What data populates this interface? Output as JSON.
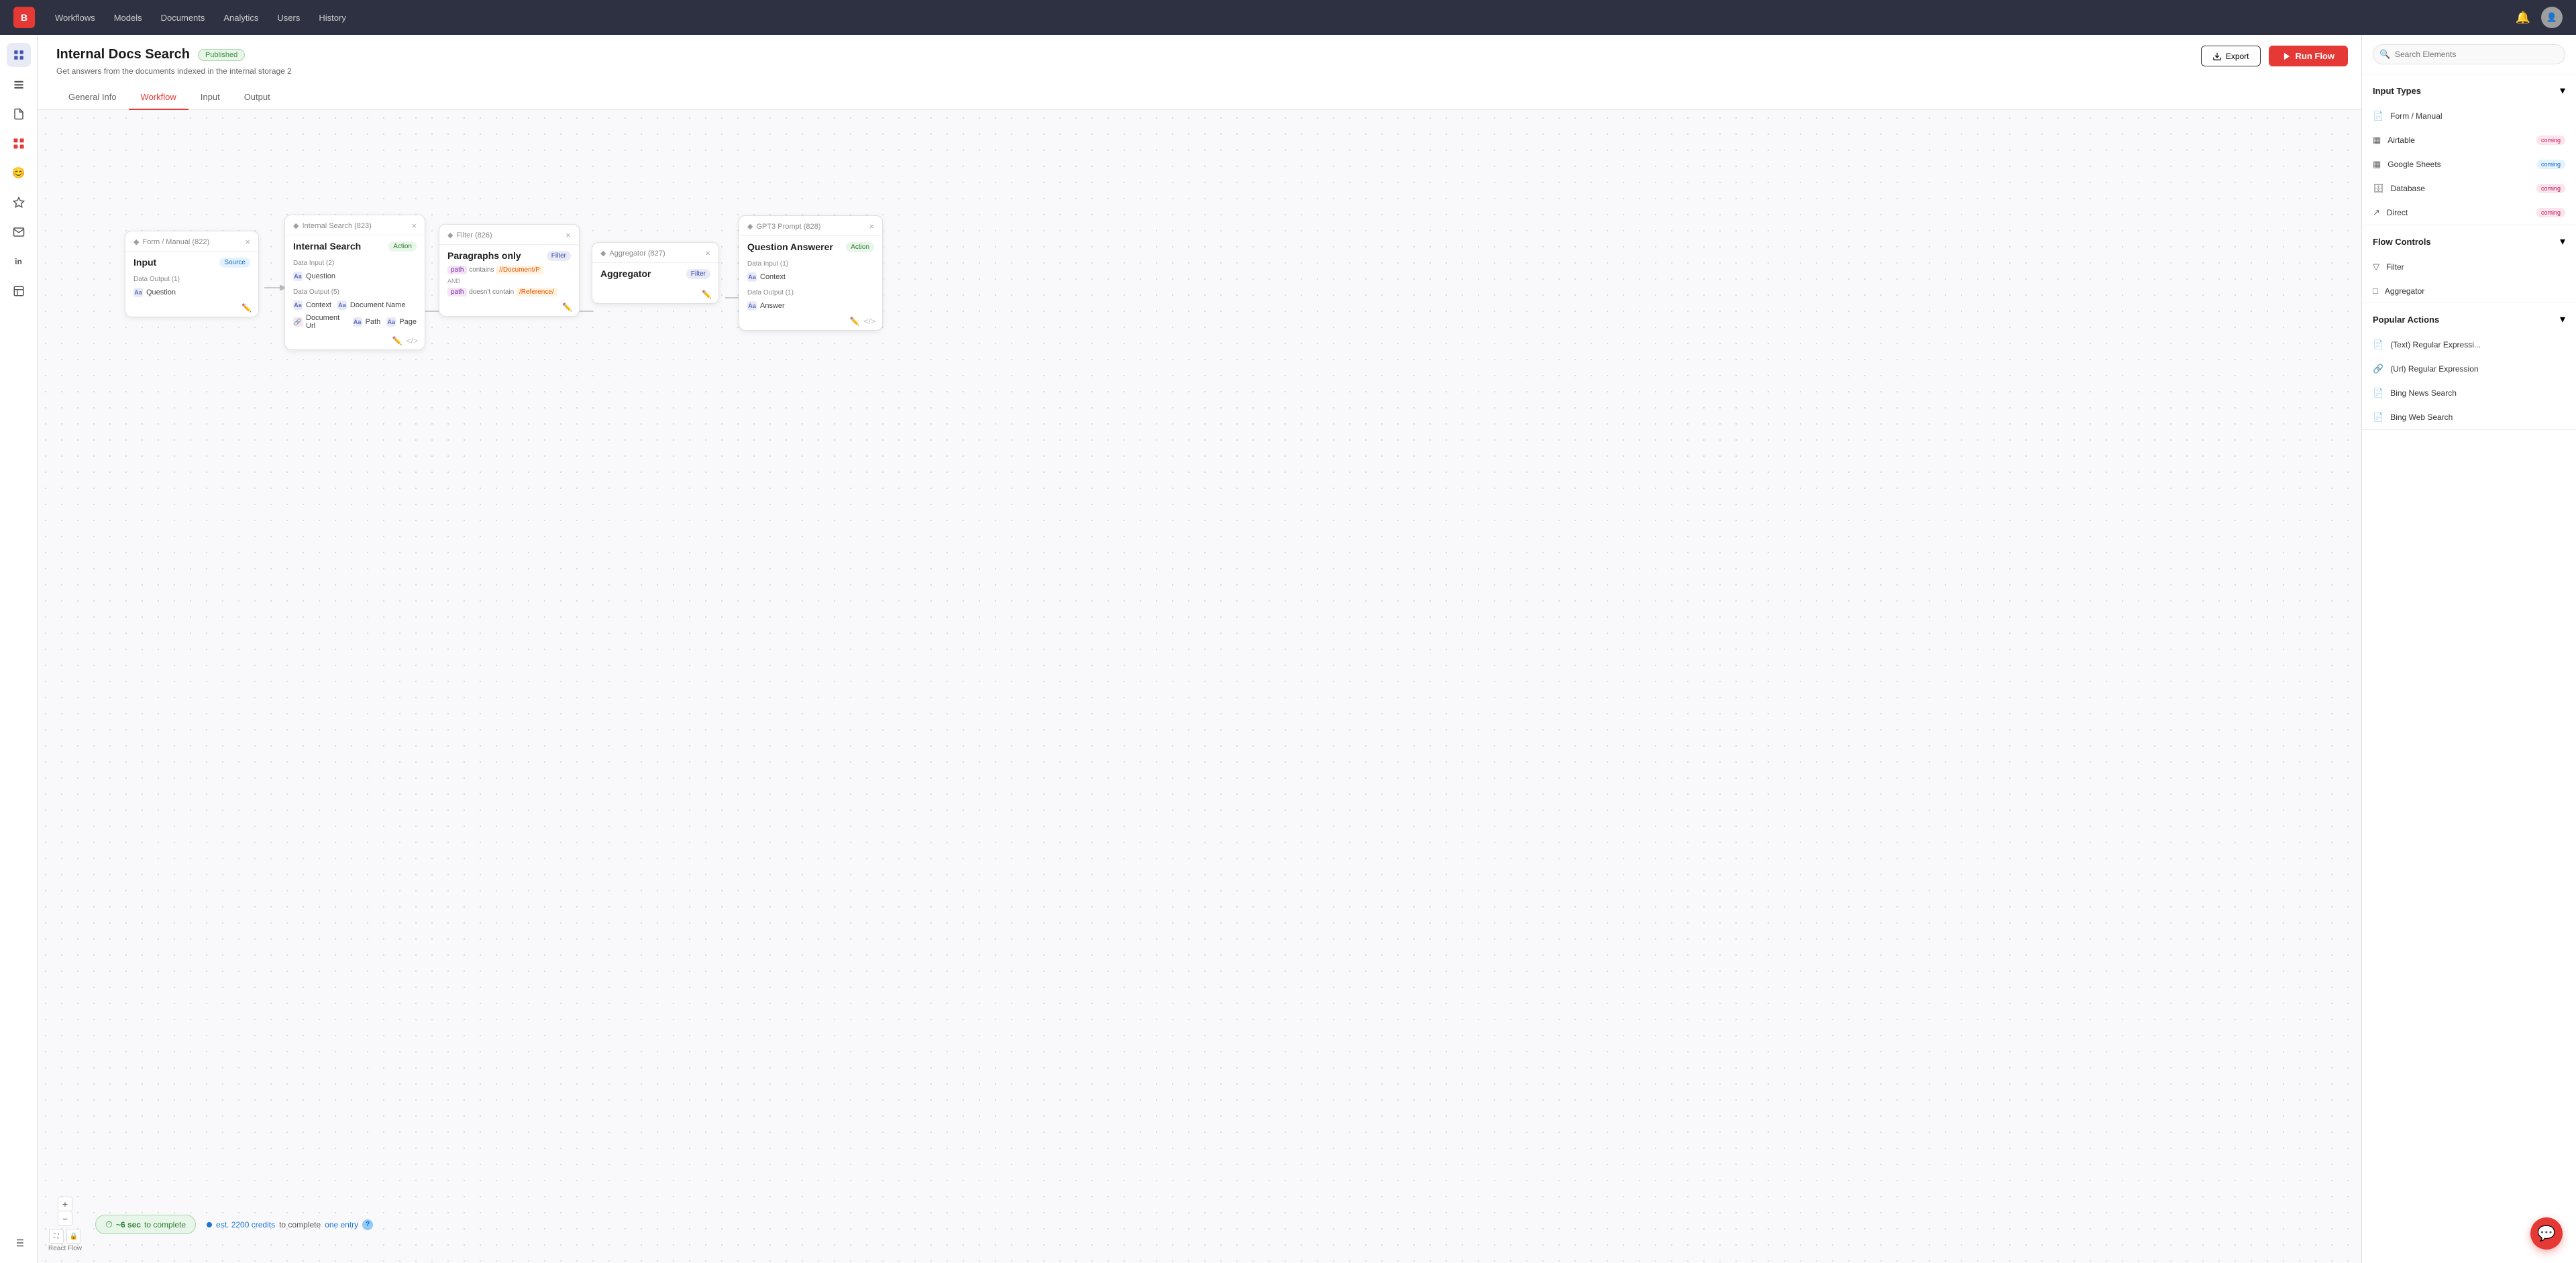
{
  "app": {
    "logo_text": "B",
    "nav_items": [
      "Workflows",
      "Models",
      "Documents",
      "Analytics",
      "Users",
      "History"
    ]
  },
  "page": {
    "title": "Internal Docs Search",
    "badge": "Published",
    "description": "Get answers from the documents indexed in the internal storage 2",
    "tabs": [
      "General Info",
      "Workflow",
      "Input",
      "Output"
    ],
    "active_tab": "Workflow"
  },
  "toolbar": {
    "export_label": "Export",
    "run_flow_label": "Run Flow"
  },
  "nodes": {
    "form_manual": {
      "header_label": "Form / Manual (822)",
      "title": "Input",
      "badge": "Source",
      "data_output_label": "Data Output (1)",
      "field1": "Question"
    },
    "internal_search": {
      "header_label": "Internal Search (823)",
      "title": "Internal Search",
      "badge": "Action",
      "data_input_label": "Data Input (2)",
      "input_field1": "Question",
      "data_output_label": "Data Output (5)",
      "output_field1": "Context",
      "output_field2": "Document Name",
      "output_field3": "Document Url",
      "output_field4": "Path",
      "output_field5": "Page"
    },
    "filter": {
      "header_label": "Filter (826)",
      "title": "Paragraphs only",
      "badge": "Filter",
      "cond1_field": "path",
      "cond1_op": "contains",
      "cond1_val": "//Document/P",
      "and_label": "AND",
      "cond2_field": "path",
      "cond2_op": "doesn't contain",
      "cond2_val": "/Reference/"
    },
    "aggregator": {
      "header_label": "Aggregator (827)",
      "title": "Aggregator",
      "badge": "Filter"
    },
    "gpt3": {
      "header_label": "GPT3 Prompt (828)",
      "title": "Question Answerer",
      "badge": "Action",
      "data_input_label": "Data Input (1)",
      "input_field1": "Context",
      "data_output_label": "Data Output (1)",
      "output_field1": "Answer"
    }
  },
  "status": {
    "time_label": "~6 sec",
    "time_suffix": "to complete",
    "credits_prefix": "est. 2200 credits",
    "credits_suffix": "to complete",
    "one_entry": "one entry",
    "react_flow_label": "React Flow"
  },
  "right_panel": {
    "search_placeholder": "Search Elements",
    "input_types_label": "Input Types",
    "items_input": [
      {
        "icon": "📄",
        "label": "Form / Manual",
        "badge": null
      },
      {
        "icon": "▦",
        "label": "Airtable",
        "badge": "coming"
      },
      {
        "icon": "▦",
        "label": "Google Sheets",
        "badge": "coming"
      },
      {
        "icon": "🗄",
        "label": "Database",
        "badge": "coming"
      },
      {
        "icon": "↗",
        "label": "Direct",
        "badge": "coming"
      }
    ],
    "flow_controls_label": "Flow Controls",
    "items_flow": [
      {
        "icon": "▽",
        "label": "Filter",
        "badge": null
      },
      {
        "icon": "□",
        "label": "Aggregator",
        "badge": null
      }
    ],
    "popular_actions_label": "Popular Actions",
    "items_popular": [
      {
        "icon": "📄",
        "label": "(Text) Regular Expressi...",
        "badge": null
      },
      {
        "icon": "🔗",
        "label": "(Url) Regular Expression",
        "badge": null
      },
      {
        "icon": "📄",
        "label": "Bing News Search",
        "badge": null
      },
      {
        "icon": "📄",
        "label": "Bing Web Search",
        "badge": null
      }
    ]
  },
  "sidebar_icons": [
    {
      "name": "workflows-icon",
      "symbol": "⬛",
      "active": false
    },
    {
      "name": "models-icon",
      "symbol": "◼",
      "active": false
    },
    {
      "name": "documents-icon",
      "symbol": "📄",
      "active": false
    },
    {
      "name": "active-icon",
      "symbol": "📊",
      "active": true
    },
    {
      "name": "emoji-icon",
      "symbol": "😊",
      "active": false
    },
    {
      "name": "magic-icon",
      "symbol": "✨",
      "active": false
    },
    {
      "name": "mail-icon",
      "symbol": "✉",
      "active": false
    },
    {
      "name": "linkedin-icon",
      "symbol": "in",
      "active": false
    },
    {
      "name": "page-icon",
      "symbol": "📋",
      "active": false
    },
    {
      "name": "list-icon",
      "symbol": "☰",
      "active": false
    }
  ]
}
